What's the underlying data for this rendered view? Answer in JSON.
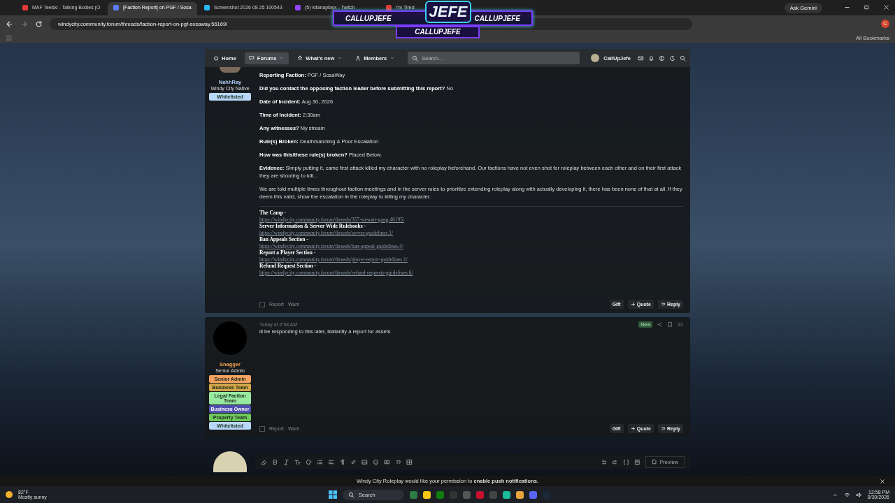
{
  "browser": {
    "tabs": [
      {
        "label": "MAF Teeski - Talking Bodies (O",
        "selected": false,
        "color": "#e53935"
      },
      {
        "label": "[Faction Report] on PGF / Sosa",
        "selected": true,
        "color": "#5c7cfa"
      },
      {
        "label": "Screenshot 2026 08 25 100543",
        "selected": false,
        "color": "#29b6f6"
      },
      {
        "label": "(5) kitanaplayx - Twitch",
        "selected": false,
        "color": "#9146ff"
      },
      {
        "label": "I'm Tired",
        "selected": false,
        "color": "#e53935"
      }
    ],
    "gemini": "Ask Gemini",
    "url": "windycity.community.forum/threads/faction-report-on-pgf-sosaway.56169/",
    "profile": "C",
    "bookmarks": "All Bookmarks"
  },
  "stream_overlay": {
    "logo": "JEFE",
    "handles": [
      "CALLUPJEFE",
      "CALLUPJEFE",
      "CALLUPJEFE"
    ]
  },
  "forum_nav": {
    "items": [
      {
        "label": "Home",
        "selected": false,
        "dropdown": false
      },
      {
        "label": "Forums",
        "selected": true,
        "dropdown": true
      },
      {
        "label": "What's new",
        "selected": false,
        "dropdown": true
      },
      {
        "label": "Members",
        "selected": false,
        "dropdown": true
      }
    ],
    "search": {
      "placeholder": "Search..."
    },
    "user": "CallUpJefe"
  },
  "posts": [
    {
      "author": {
        "name": "NahhRay",
        "color": "#a8c8f0"
      },
      "user_title": "Windy City Native",
      "avatar": {
        "kind": "photo"
      },
      "selected": false,
      "badges": [
        {
          "label": "Whitelisted",
          "color": "#b8d8f8"
        }
      ],
      "fields": [
        {
          "label": "Reporting Faction:",
          "value": "PGF / SosaWay"
        },
        {
          "label": "Did you contact the opposing faction leader before submitting this report?",
          "value": "No"
        },
        {
          "label": "Date of Incident:",
          "value": "Aug 30, 2026"
        },
        {
          "label": "Time of Incident:",
          "value": "2:30am"
        },
        {
          "label": "Any witnesses?",
          "value": "My stream"
        },
        {
          "label": "Rule(s) Broken:",
          "value": "Deathmatching & Poor Escalation"
        },
        {
          "label": "How was this/these rule(s) broken?",
          "value": "Placed Below."
        },
        {
          "label": "Evidence:",
          "value": "Simply putting it, came first attack killed my character with no roleplay beforehand. Our factions have not even shot for roleplay between each other and on their first attack they are shooting to kill..."
        }
      ],
      "paragraphs": [
        "We are told multiple times throughout faction meetings and in the server rules to prioritize extending roleplay along with actually developing it, there has been none of that at all. If they deem this valid, show the escalation in the roleplay to killing my character."
      ],
      "links": [
        {
          "title": "The Camp -",
          "url": "https://windycity.community.forum/threads/357-stewart-gang.46195/"
        },
        {
          "title": "Server Information & Server Wide Rulebooks -",
          "url": "https://windycity.community.forum/threads/server-guidelines.1/"
        },
        {
          "title": "Ban Appeals Section -",
          "url": "https://windycity.community.forum/threads/ban-appeal-guidelines.4/"
        },
        {
          "title": "Report a Player Section -",
          "url": "https://windycity.community.forum/threads/player-report-guidelines.1/"
        },
        {
          "title": "Refund Request Section -",
          "url": "https://windycity.community.forum/threads/refund-requests-guidelines.6/"
        }
      ],
      "footer_left": [
        "Report",
        "Warn"
      ],
      "actions": [
        "Gift",
        "Quote",
        "Reply"
      ]
    },
    {
      "author": {
        "name": "Snagger",
        "color": "#f0a050"
      },
      "user_title": "Senior Admin",
      "avatar": {
        "kind": "circle"
      },
      "selected": false,
      "time": "Today at 2:58 AM",
      "new_label": "New",
      "number": "#2",
      "badges": [
        {
          "label": "Senior Admin",
          "color": "#f4a261"
        },
        {
          "label": "Business Team",
          "color": "#d4a84a"
        },
        {
          "label": "Legal Faction Team",
          "color": "#98e8a0"
        },
        {
          "label": "Business Owner",
          "color": "#5050b0"
        },
        {
          "label": "Property Team",
          "color": "#70c860"
        },
        {
          "label": "Whitelisted",
          "color": "#b8d8f8"
        }
      ],
      "paragraphs": [
        "ill be responding to this later, blatantly a report for assets"
      ],
      "footer_left": [
        "Report",
        "Warn"
      ],
      "actions": [
        "Gift",
        "Quote",
        "Reply"
      ]
    }
  ],
  "editor": {
    "preview": "Preview"
  },
  "notification": "Windy City Roleplay would like your permission to **enable push notifications.**",
  "taskbar": {
    "temperature": "82°F",
    "weather": "Mostly sunny",
    "search": "Search",
    "time": "12:58 PM",
    "date": "8/30/2026"
  }
}
